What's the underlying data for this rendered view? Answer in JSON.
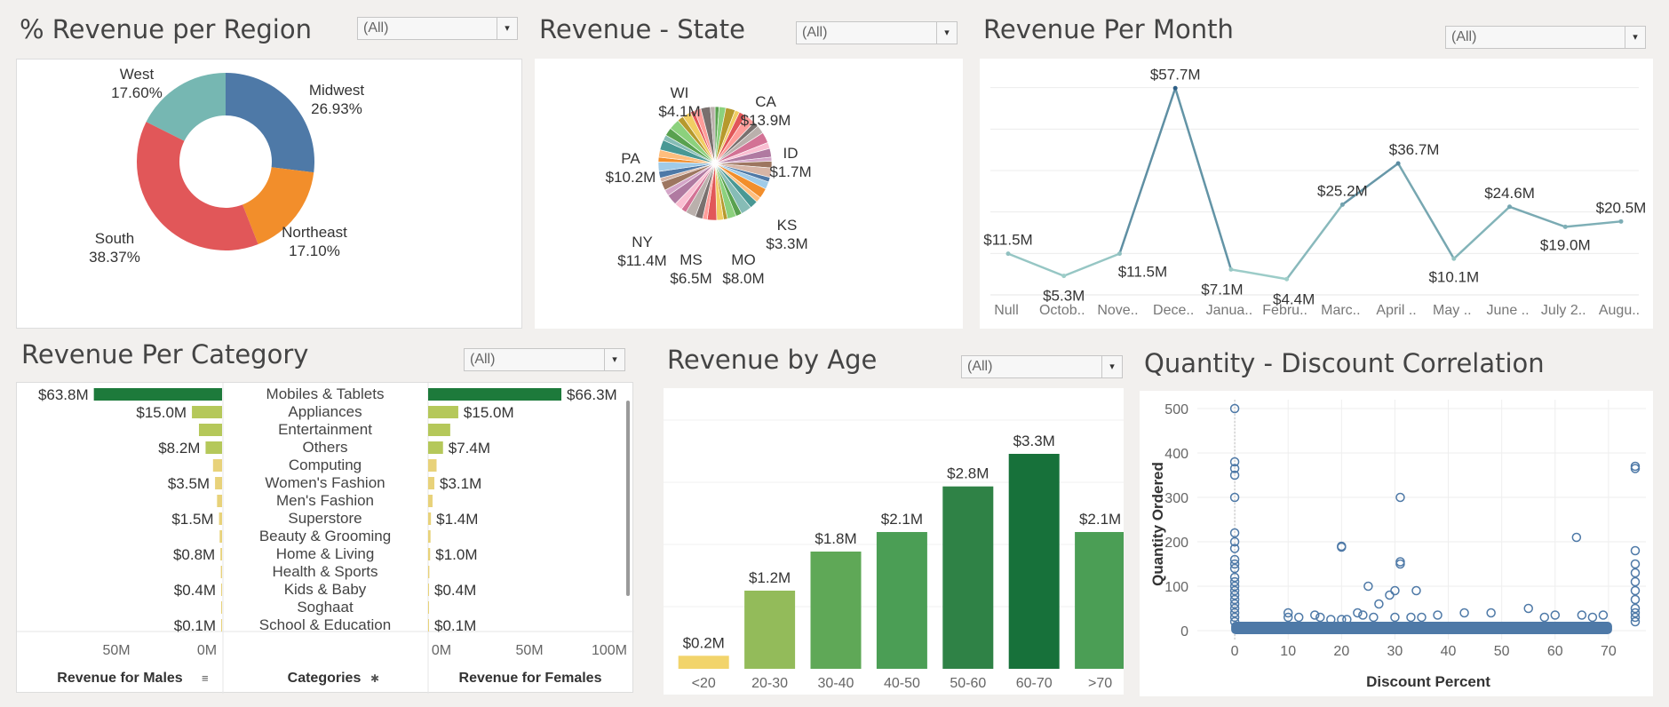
{
  "panels": {
    "region": {
      "title": "% Revenue per Region",
      "filter": "(All)"
    },
    "state": {
      "title": "Revenue - State",
      "filter": "(All)"
    },
    "month": {
      "title": "Revenue Per Month",
      "filter": "(All)"
    },
    "category": {
      "title": "Revenue Per Category",
      "filter": "(All)"
    },
    "age": {
      "title": "Revenue by Age",
      "filter": "(All)"
    },
    "discount": {
      "title": "Quantity - Discount Correlation"
    }
  },
  "chart_data": [
    {
      "id": "region",
      "type": "pie",
      "variant": "donut",
      "title": "% Revenue per Region",
      "slices": [
        {
          "label": "Midwest",
          "value": 26.93,
          "text": "26.93%",
          "color": "#4e79a7"
        },
        {
          "label": "Northeast",
          "value": 17.1,
          "text": "17.10%",
          "color": "#f28e2b"
        },
        {
          "label": "South",
          "value": 38.37,
          "text": "38.37%",
          "color": "#e15759"
        },
        {
          "label": "West",
          "value": 17.6,
          "text": "17.60%",
          "color": "#76b7b2"
        }
      ]
    },
    {
      "id": "state",
      "type": "pie",
      "title": "Revenue - State",
      "labeled": [
        {
          "label": "WI",
          "value": "$4.1M"
        },
        {
          "label": "CA",
          "value": "$13.9M"
        },
        {
          "label": "ID",
          "value": "$1.7M"
        },
        {
          "label": "PA",
          "value": "$10.2M"
        },
        {
          "label": "KS",
          "value": "$3.3M"
        },
        {
          "label": "NY",
          "value": "$11.4M"
        },
        {
          "label": "MS",
          "value": "$6.5M"
        },
        {
          "label": "MO",
          "value": "$8.0M"
        }
      ],
      "slice_colors": [
        "#59a14f",
        "#8cd17d",
        "#b6992d",
        "#f1ce63",
        "#e15759",
        "#ff9d9a",
        "#79706e",
        "#bab0ac",
        "#d37295",
        "#fabfd2",
        "#b07aa1",
        "#d4a6c8",
        "#9d7660",
        "#d7b5a6",
        "#4e79a7",
        "#a0cbe8",
        "#f28e2b",
        "#ffbe7d",
        "#499894",
        "#86bcb6"
      ]
    },
    {
      "id": "month",
      "type": "line",
      "title": "Revenue Per Month",
      "categories": [
        "Null",
        "Octob..",
        "Nove..",
        "Dece..",
        "Janua..",
        "Febru..",
        "Marc..",
        "April ..",
        "May ..",
        "June ..",
        "July 2..",
        "Augu.."
      ],
      "values": [
        11.5,
        5.3,
        11.5,
        57.7,
        7.1,
        4.4,
        25.2,
        36.7,
        10.1,
        24.6,
        19.0,
        20.5
      ],
      "labels": [
        "$11.5M",
        "$5.3M",
        "$11.5M",
        "$57.7M",
        "$7.1M",
        "$4.4M",
        "$25.2M",
        "$36.7M",
        "$10.1M",
        "$24.6M",
        "$19.0M",
        "$20.5M"
      ],
      "ylim": [
        0,
        60
      ],
      "grid": true,
      "colors": {
        "low": "#a8d8cf",
        "high": "#2e5f86"
      }
    },
    {
      "id": "category",
      "type": "bar",
      "orientation": "horizontal",
      "title": "Revenue Per Category",
      "categories": [
        "Mobiles & Tablets",
        "Appliances",
        "Entertainment",
        "Others",
        "Computing",
        "Women's Fashion",
        "Men's Fashion",
        "Superstore",
        "Beauty & Grooming",
        "Home & Living",
        "Health & Sports",
        "Kids & Baby",
        "Soghaat",
        "School & Education"
      ],
      "series": [
        {
          "name": "Revenue for Males",
          "values": [
            63.8,
            15.0,
            11.5,
            8.2,
            4.5,
            3.5,
            2.5,
            1.5,
            1.2,
            0.8,
            0.6,
            0.4,
            0.2,
            0.1
          ],
          "labels": [
            "$63.8M",
            "$15.0M",
            "",
            "$8.2M",
            "",
            "$3.5M",
            "",
            "$1.5M",
            "",
            "$0.8M",
            "",
            "$0.4M",
            "",
            "$0.1M"
          ],
          "xlim": [
            0,
            100
          ]
        },
        {
          "name": "Revenue for Females",
          "values": [
            66.3,
            15.0,
            11.0,
            7.4,
            4.2,
            3.1,
            2.2,
            1.4,
            1.2,
            1.0,
            0.6,
            0.4,
            0.2,
            0.1
          ],
          "labels": [
            "$66.3M",
            "$15.0M",
            "",
            "$7.4M",
            "",
            "$3.1M",
            "",
            "$1.4M",
            "",
            "$1.0M",
            "",
            "$0.4M",
            "",
            "$0.1M"
          ],
          "xlim": [
            0,
            100
          ]
        }
      ],
      "axis_labels": {
        "males": "Revenue for Males",
        "categories": "Categories",
        "females": "Revenue for Females"
      },
      "male_ticks": [
        "50M",
        "0M"
      ],
      "female_ticks": [
        "0M",
        "50M",
        "100M"
      ],
      "colors": {
        "high": "#1d7a3b",
        "mid": "#b5c85a",
        "low": "#e8d27a"
      }
    },
    {
      "id": "age",
      "type": "bar",
      "title": "Revenue by Age",
      "categories": [
        "<20",
        "20-30",
        "30-40",
        "40-50",
        "50-60",
        "60-70",
        ">70"
      ],
      "values": [
        0.2,
        1.2,
        1.8,
        2.1,
        2.8,
        3.3,
        2.1
      ],
      "labels": [
        "$0.2M",
        "$1.2M",
        "$1.8M",
        "$2.1M",
        "$2.8M",
        "$3.3M",
        "$2.1M"
      ],
      "ylim": [
        0,
        3.5
      ],
      "colors": [
        "#f2d46b",
        "#93bb5a",
        "#5fa857",
        "#4b9e55",
        "#2f8246",
        "#17713a",
        "#4b9e55"
      ]
    },
    {
      "id": "discount",
      "type": "scatter",
      "title": "Quantity - Discount Correlation",
      "xlabel": "Discount Percent",
      "ylabel": "Quantity Ordered",
      "xlim": [
        -7,
        77
      ],
      "ylim": [
        -20,
        520
      ],
      "xticks": [
        0,
        10,
        20,
        30,
        40,
        50,
        60,
        70
      ],
      "yticks": [
        0,
        100,
        200,
        300,
        400,
        500
      ],
      "grid": true,
      "points": [
        [
          0,
          500
        ],
        [
          0,
          380
        ],
        [
          0,
          365
        ],
        [
          0,
          350
        ],
        [
          0,
          300
        ],
        [
          0,
          220
        ],
        [
          0,
          200
        ],
        [
          0,
          185
        ],
        [
          0,
          160
        ],
        [
          0,
          150
        ],
        [
          0,
          140
        ],
        [
          0,
          120
        ],
        [
          0,
          110
        ],
        [
          0,
          100
        ],
        [
          0,
          90
        ],
        [
          0,
          80
        ],
        [
          0,
          70
        ],
        [
          0,
          60
        ],
        [
          0,
          50
        ],
        [
          0,
          40
        ],
        [
          0,
          30
        ],
        [
          0,
          20
        ],
        [
          10,
          40
        ],
        [
          10,
          30
        ],
        [
          12,
          30
        ],
        [
          15,
          35
        ],
        [
          16,
          30
        ],
        [
          18,
          25
        ],
        [
          20,
          190
        ],
        [
          20,
          188
        ],
        [
          20,
          25
        ],
        [
          21,
          25
        ],
        [
          23,
          40
        ],
        [
          24,
          35
        ],
        [
          25,
          100
        ],
        [
          26,
          30
        ],
        [
          27,
          60
        ],
        [
          29,
          80
        ],
        [
          30,
          90
        ],
        [
          30,
          30
        ],
        [
          31,
          155
        ],
        [
          31,
          150
        ],
        [
          31,
          300
        ],
        [
          33,
          30
        ],
        [
          34,
          90
        ],
        [
          35,
          30
        ],
        [
          38,
          35
        ],
        [
          43,
          40
        ],
        [
          48,
          40
        ],
        [
          55,
          50
        ],
        [
          58,
          30
        ],
        [
          60,
          35
        ],
        [
          64,
          210
        ],
        [
          65,
          35
        ],
        [
          67,
          30
        ],
        [
          69,
          35
        ],
        [
          75,
          370
        ],
        [
          75,
          365
        ],
        [
          75,
          180
        ],
        [
          75,
          150
        ],
        [
          75,
          130
        ],
        [
          75,
          110
        ],
        [
          75,
          90
        ],
        [
          75,
          70
        ],
        [
          75,
          50
        ],
        [
          75,
          40
        ],
        [
          75,
          30
        ],
        [
          75,
          20
        ]
      ],
      "dense_band": {
        "x": [
          0,
          70
        ],
        "y": [
          0,
          20
        ]
      },
      "color": "#4e79a7"
    }
  ]
}
